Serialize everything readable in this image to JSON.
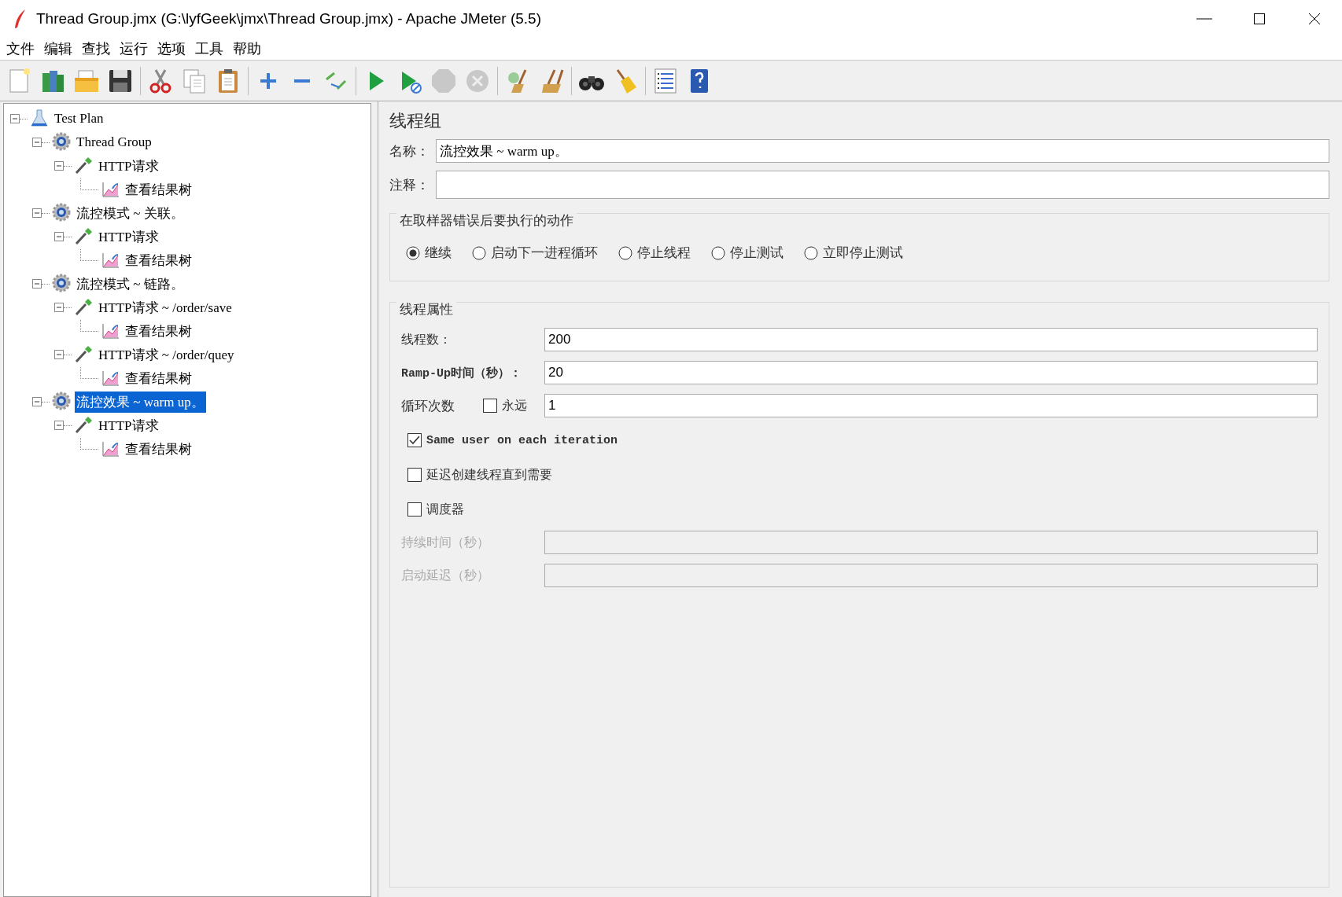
{
  "window": {
    "title": "Thread Group.jmx (G:\\lyfGeek\\jmx\\Thread Group.jmx) - Apache JMeter (5.5)"
  },
  "menu": [
    "文件",
    "编辑",
    "查找",
    "运行",
    "选项",
    "工具",
    "帮助"
  ],
  "tree": [
    {
      "label": "Test Plan",
      "kind": "plan",
      "selected": false,
      "expanded": true,
      "children": [
        {
          "label": "Thread Group",
          "kind": "thread_group",
          "selected": false,
          "expanded": true,
          "children": [
            {
              "label": "HTTP请求",
              "kind": "sampler",
              "selected": false,
              "expanded": true,
              "children": [
                {
                  "label": "查看结果树",
                  "kind": "listener",
                  "selected": false
                }
              ]
            }
          ]
        },
        {
          "label": "流控模式 ~ 关联。",
          "kind": "thread_group",
          "selected": false,
          "expanded": true,
          "children": [
            {
              "label": "HTTP请求",
              "kind": "sampler",
              "selected": false,
              "expanded": true,
              "children": [
                {
                  "label": "查看结果树",
                  "kind": "listener",
                  "selected": false
                }
              ]
            }
          ]
        },
        {
          "label": "流控模式 ~ 链路。",
          "kind": "thread_group",
          "selected": false,
          "expanded": true,
          "children": [
            {
              "label": "HTTP请求 ~ /order/save",
              "kind": "sampler",
              "selected": false,
              "expanded": true,
              "children": [
                {
                  "label": "查看结果树",
                  "kind": "listener",
                  "selected": false
                }
              ]
            },
            {
              "label": "HTTP请求 ~ /order/quey",
              "kind": "sampler",
              "selected": false,
              "expanded": true,
              "children": [
                {
                  "label": "查看结果树",
                  "kind": "listener",
                  "selected": false
                }
              ]
            }
          ]
        },
        {
          "label": "流控效果 ~ warm up。",
          "kind": "thread_group",
          "selected": true,
          "expanded": true,
          "children": [
            {
              "label": "HTTP请求",
              "kind": "sampler",
              "selected": false,
              "expanded": true,
              "children": [
                {
                  "label": "查看结果树",
                  "kind": "listener",
                  "selected": false
                }
              ]
            }
          ]
        }
      ]
    }
  ],
  "panel": {
    "title": "线程组",
    "name": {
      "label": "名称：",
      "value": "流控效果 ~ warm up。"
    },
    "comment": {
      "label": "注释："
    },
    "error_action": {
      "title": "在取样器错误后要执行的动作",
      "options": [
        {
          "label": "继续",
          "selected": true
        },
        {
          "label": "启动下一进程循环",
          "selected": false
        },
        {
          "label": "停止线程",
          "selected": false
        },
        {
          "label": "停止测试",
          "selected": false
        },
        {
          "label": "立即停止测试",
          "selected": false
        }
      ]
    },
    "thread_properties": {
      "title": "线程属性",
      "threads": {
        "label": "线程数：",
        "value": "200"
      },
      "ramp_up": {
        "label": "Ramp-Up时间（秒）：",
        "value": "20"
      },
      "loop": {
        "label": "循环次数",
        "forever": {
          "label": "永远",
          "checked": false
        },
        "value": "1"
      },
      "checks": [
        {
          "label": "Same user on each iteration",
          "checked": true
        },
        {
          "label": "延迟创建线程直到需要",
          "checked": false
        },
        {
          "label": "调度器",
          "checked": false
        }
      ],
      "duration": {
        "label": "持续时间（秒）",
        "disabled": true
      },
      "delay": {
        "label": "启动延迟（秒）",
        "disabled": true
      }
    }
  }
}
